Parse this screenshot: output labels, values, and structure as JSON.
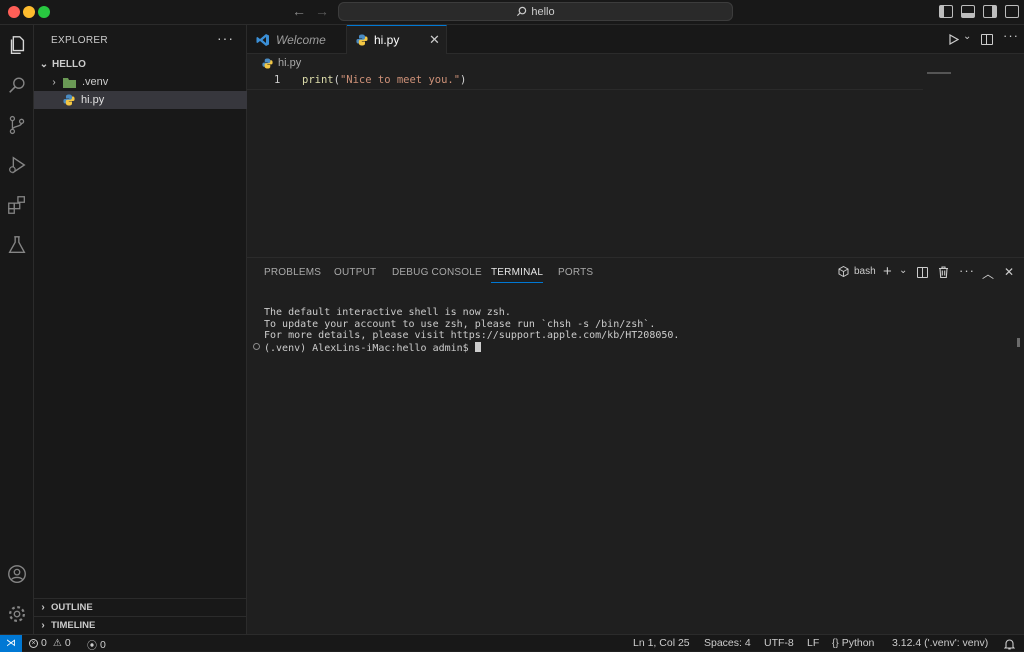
{
  "window": {
    "search": "hello",
    "traffic_lights": {
      "close": "#ff5f57",
      "minimize": "#febc2e",
      "maximize": "#28c840"
    }
  },
  "explorer": {
    "title": "EXPLORER",
    "folder": "HELLO",
    "items": [
      {
        "label": ".venv",
        "type": "folder",
        "icon": "folder-icon"
      },
      {
        "label": "hi.py",
        "type": "file",
        "icon": "python-icon",
        "selected": true
      }
    ],
    "sections": [
      "OUTLINE",
      "TIMELINE"
    ]
  },
  "editor": {
    "tabs": [
      {
        "label": "Welcome",
        "icon": "vscode-icon"
      },
      {
        "label": "hi.py",
        "icon": "python-icon",
        "active": true
      }
    ],
    "breadcrumb": "hi.py",
    "lines": [
      {
        "number": "1",
        "fn": "print",
        "open": "(",
        "string": "\"Nice to meet you.\"",
        "close": ")"
      }
    ]
  },
  "panel": {
    "tabs": [
      "PROBLEMS",
      "OUTPUT",
      "DEBUG CONSOLE",
      "TERMINAL",
      "PORTS"
    ],
    "active_tab": "TERMINAL",
    "shell": "bash",
    "terminal_lines": [
      "The default interactive shell is now zsh.",
      "To update your account to use zsh, please run `chsh -s /bin/zsh`.",
      "For more details, please visit https://support.apple.com/kb/HT208050."
    ],
    "prompt": "(.venv) AlexLins-iMac:hello admin$ "
  },
  "statusbar": {
    "errors": "0",
    "warnings": "0",
    "ports": "0",
    "position": "Ln 1, Col 25",
    "spaces": "Spaces: 4",
    "encoding": "UTF-8",
    "eol": "LF",
    "language": "Python",
    "interpreter": "3.12.4 ('.venv': venv)"
  },
  "colors": {
    "accent": "#0078d4",
    "background": "#1f1f1f",
    "sidebar": "#181818"
  }
}
